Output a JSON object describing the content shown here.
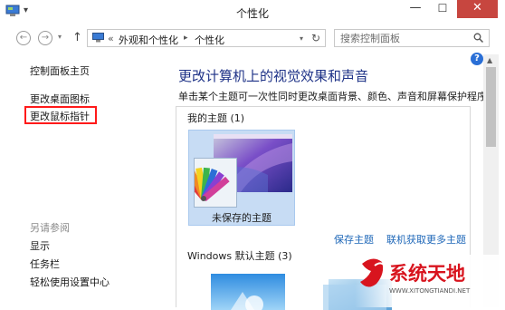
{
  "window": {
    "title": "个性化",
    "minimize": "—",
    "maximize": "☐",
    "close": "✕"
  },
  "nav": {
    "back": "←",
    "forward": "→",
    "up": "↑",
    "address_lead": "«",
    "breadcrumb": [
      "外观和个性化",
      "个性化"
    ],
    "breadcrumb_sep": "▸",
    "refresh": "↻",
    "search_placeholder": "搜索控制面板"
  },
  "left_pane": {
    "links": [
      "控制面板主页",
      "更改桌面图标",
      "更改鼠标指针"
    ],
    "see_also_title": "另请参阅",
    "see_also": [
      "显示",
      "任务栏",
      "轻松使用设置中心"
    ]
  },
  "main": {
    "help": "?",
    "title": "更改计算机上的视觉效果和声音",
    "description": "单击某个主题可一次性同时更改桌面背景、颜色、声音和屏幕保护程序。",
    "my_themes_header": "我的主题 (1)",
    "unsaved_theme_label": "未保存的主题",
    "save_theme": "保存主题",
    "get_more_themes": "联机获取更多主题",
    "windows_themes_header": "Windows 默认主题 (3)"
  },
  "watermark": {
    "brand": "系统天地",
    "url": "WWW.XITONGTIANDI.NET"
  },
  "colors": {
    "title_blue": "#1e3287",
    "link_blue": "#1e67b8",
    "close_red": "#c7463f",
    "highlight_red": "#ff1a1a",
    "selection_blue": "#c7dcf4"
  }
}
